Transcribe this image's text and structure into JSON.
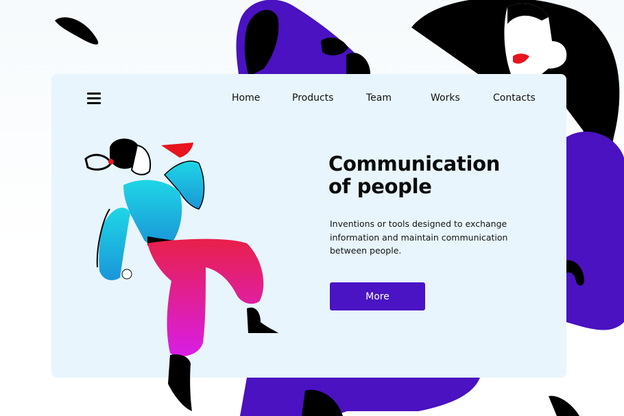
{
  "nav": {
    "menu_icon": "hamburger-menu-icon",
    "items": [
      {
        "label": "Home"
      },
      {
        "label": "Products"
      },
      {
        "label": "Team"
      },
      {
        "label": "Works"
      },
      {
        "label": "Contacts"
      }
    ]
  },
  "hero": {
    "title_line1": "Communication",
    "title_line2": "of people",
    "description": "Inventions or tools designed to exchange information and maintain communication between people.",
    "button_label": "More"
  },
  "colors": {
    "accent": "#4a14c4",
    "card_background": "#e8f5fc",
    "illustration_purple": "#4a12c0",
    "illustration_cyan": "#1fc8e0",
    "illustration_magenta": "#e020c8",
    "lips_red": "#e8141e"
  },
  "illustrations": {
    "background": "woman-with-megaphone-illustration",
    "foreground": "man-with-megaphone-illustration"
  }
}
